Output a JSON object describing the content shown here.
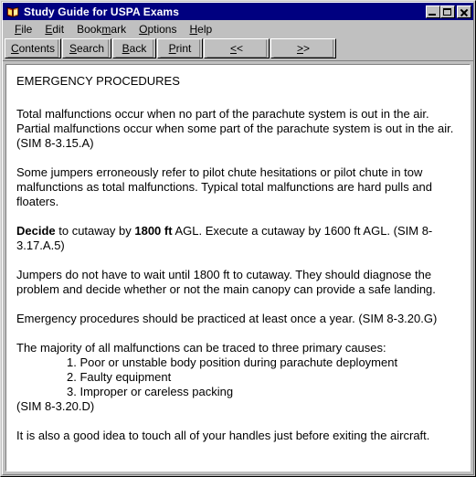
{
  "window": {
    "title": "Study Guide for USPA Exams",
    "icon": "book-icon",
    "title_bar_color": "#000080",
    "face_color": "#c0c0c0",
    "controls": {
      "minimize": "minimize-icon",
      "maximize": "maximize-icon",
      "close": "close-icon"
    }
  },
  "menu": {
    "items": [
      {
        "label": "File",
        "accel": "F"
      },
      {
        "label": "Edit",
        "accel": "E"
      },
      {
        "label": "Bookmark",
        "accel": "m"
      },
      {
        "label": "Options",
        "accel": "O"
      },
      {
        "label": "Help",
        "accel": "H"
      }
    ]
  },
  "toolbar": {
    "buttons": [
      {
        "label": "Contents",
        "accel": "C"
      },
      {
        "label": "Search",
        "accel": "S"
      },
      {
        "label": "Back",
        "accel": "B"
      },
      {
        "label": "Print",
        "accel": "P"
      },
      {
        "label": "<<",
        "accel": "<"
      },
      {
        "label": ">>",
        "accel": ">"
      }
    ]
  },
  "document": {
    "heading": "EMERGENCY PROCEDURES",
    "paragraph_1_line_1": "Total malfunctions occur when no part of the parachute system is out in the air.",
    "paragraph_1_line_2": "Partial malfunctions occur when some part of the parachute system is out in the air.",
    "paragraph_1_line_3": "(SIM 8-3.15.A)",
    "paragraph_2": "Some jumpers erroneously refer to pilot chute hesitations or pilot chute in tow malfunctions as total malfunctions. Typical total malfunctions are hard pulls and floaters.",
    "paragraph_3_bold_1": "Decide",
    "paragraph_3_mid_1": " to cutaway by ",
    "paragraph_3_bold_2": "1800 ft",
    "paragraph_3_rest": " AGL. Execute a cutaway by 1600 ft AGL. (SIM 8-3.17.A.5)",
    "paragraph_4": "Jumpers do not have to wait until 1800 ft to cutaway. They should diagnose the problem and decide whether or not the main canopy can provide a safe landing.",
    "paragraph_5": "Emergency procedures should be practiced at least once a year. (SIM 8-3.20.G)",
    "paragraph_6_intro": "The majority of all malfunctions can be traced to three primary causes:",
    "list_items": [
      "1. Poor or unstable body position during parachute deployment",
      "2. Faulty equipment",
      "3. Improper or careless packing"
    ],
    "paragraph_6_citation": "(SIM 8-3.20.D)",
    "paragraph_7": "It is also a good idea to touch all of your handles just before exiting the aircraft."
  }
}
